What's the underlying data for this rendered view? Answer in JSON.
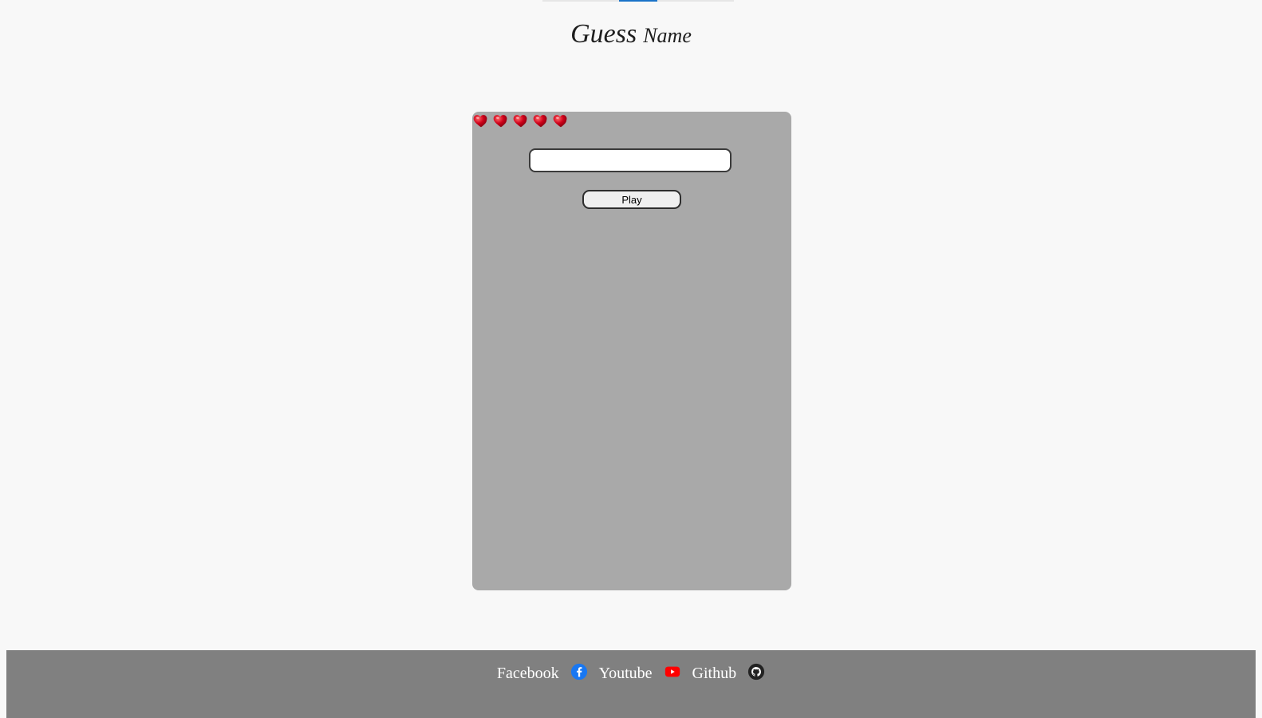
{
  "header": {
    "title_word1": "Guess",
    "title_word2": "Name"
  },
  "game": {
    "lives": 5,
    "life_icon": "heart-icon",
    "input": {
      "value": "",
      "placeholder": ""
    },
    "play_label": "Play",
    "panel_color": "#a9a9a9"
  },
  "footer": {
    "links": [
      {
        "label": "Facebook",
        "icon": "facebook-icon"
      },
      {
        "label": "Youtube",
        "icon": "youtube-icon"
      },
      {
        "label": "Github",
        "icon": "github-icon"
      }
    ],
    "background": "#808080"
  },
  "colors": {
    "page_background": "#f8f8f8",
    "heart": "#d0021b",
    "facebook": "#1877f2",
    "youtube": "#ff0000",
    "github": "#222222"
  }
}
